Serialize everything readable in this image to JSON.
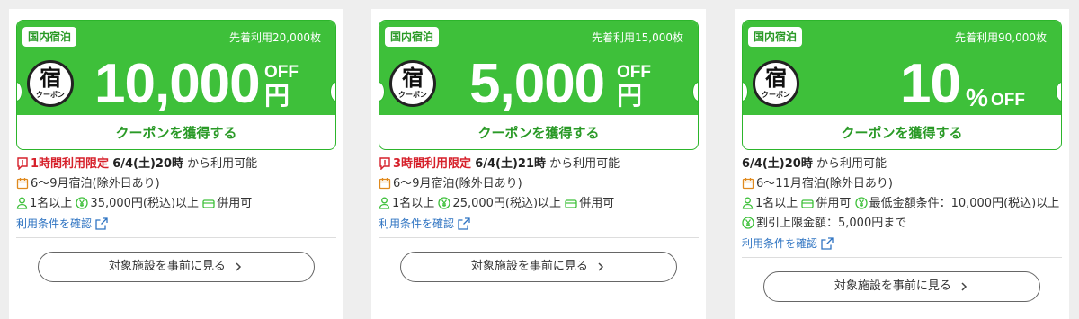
{
  "colors": {
    "green": "#3ec03a",
    "green_text": "#2a9a27",
    "red": "#d6202a",
    "link": "#2f74c2"
  },
  "cards": [
    {
      "tag": "国内宿泊",
      "first_come": "先着利用20,000枚",
      "logo_kanji": "宿",
      "logo_sub": "クーポン",
      "amount": "10,000",
      "off": "OFF",
      "unit": "円",
      "get_label": "クーポンを獲得する",
      "limit": "1時間利用限定",
      "start": "6/4(土)20時",
      "from": "から利用可能",
      "stay": "6〜9月宿泊(除外日あり)",
      "people": "1名以上",
      "min": "35,000円(税込)以上",
      "combo": "併用可",
      "terms": "利用条件を確認",
      "see": "対象施設を事前に見る",
      "icons": [
        "alert-icon",
        "calendar-icon",
        "person-icon",
        "yen-icon",
        "ticket-icon",
        "external-link-icon",
        "chevron-right-icon"
      ]
    },
    {
      "tag": "国内宿泊",
      "first_come": "先着利用15,000枚",
      "logo_kanji": "宿",
      "logo_sub": "クーポン",
      "amount": "5,000",
      "off": "OFF",
      "unit": "円",
      "get_label": "クーポンを獲得する",
      "limit": "3時間利用限定",
      "start": "6/4(土)21時",
      "from": "から利用可能",
      "stay": "6〜9月宿泊(除外日あり)",
      "people": "1名以上",
      "min": "25,000円(税込)以上",
      "combo": "併用可",
      "terms": "利用条件を確認",
      "see": "対象施設を事前に見る"
    },
    {
      "tag": "国内宿泊",
      "first_come": "先着利用90,000枚",
      "logo_kanji": "宿",
      "logo_sub": "クーポン",
      "amount": "10",
      "pct": "%",
      "off": "OFF",
      "get_label": "クーポンを獲得する",
      "start": "6/4(土)20時",
      "from": "から利用可能",
      "stay": "6〜11月宿泊(除外日あり)",
      "people": "1名以上",
      "combo": "併用可",
      "min": "最低金額条件：10,000円(税込)以上",
      "cap": "割引上限金額：5,000円まで",
      "terms": "利用条件を確認",
      "see": "対象施設を事前に見る"
    }
  ]
}
